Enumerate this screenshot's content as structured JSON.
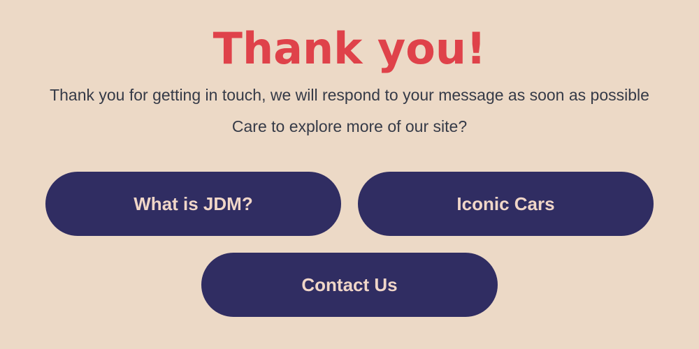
{
  "header": {
    "title": "Thank you!"
  },
  "message": {
    "line1": "Thank you for getting in touch, we will respond to your message as soon as possible",
    "line2": "Care to explore more of our site?"
  },
  "nav_buttons": {
    "jdm": "What is JDM?",
    "cars": "Iconic Cars",
    "contact": "Contact Us"
  },
  "colors": {
    "background": "#ecd9c6",
    "title": "#df424a",
    "text": "#353a47",
    "button_bg": "#302d62",
    "button_text": "#f0d6c8"
  }
}
